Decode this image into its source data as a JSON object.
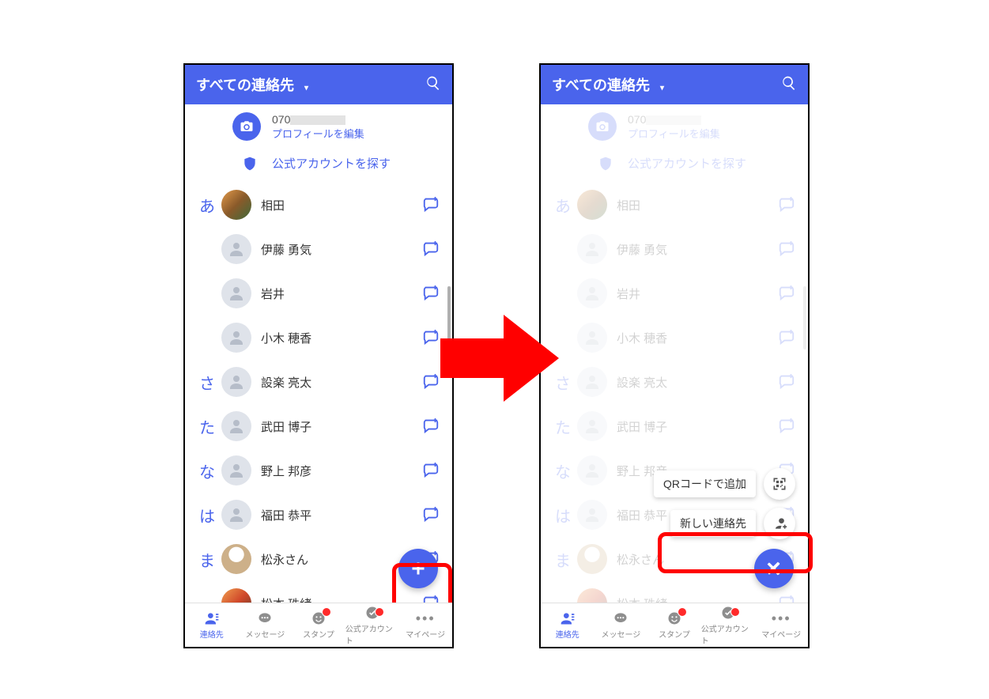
{
  "header": {
    "title": "すべての連絡先",
    "dropdown_glyph": "▾"
  },
  "profile": {
    "phone_prefix": "070",
    "edit_label": "プロフィールを編集"
  },
  "official": {
    "label": "公式アカウントを探す"
  },
  "contacts": [
    {
      "index": "あ",
      "name": "相田",
      "avatar": "img1"
    },
    {
      "index": "",
      "name": "伊藤 勇気",
      "avatar": "default"
    },
    {
      "index": "",
      "name": "岩井",
      "avatar": "default"
    },
    {
      "index": "",
      "name": "小木 穂香",
      "avatar": "default"
    },
    {
      "index": "さ",
      "name": "設楽 亮太",
      "avatar": "default"
    },
    {
      "index": "た",
      "name": "武田 博子",
      "avatar": "default"
    },
    {
      "index": "な",
      "name": "野上 邦彦",
      "avatar": "default"
    },
    {
      "index": "は",
      "name": "福田 恭平",
      "avatar": "default"
    },
    {
      "index": "ま",
      "name": "松永さん",
      "avatar": "img2"
    },
    {
      "index": "",
      "name": "松本 珠緒",
      "avatar": "img3"
    }
  ],
  "fab": {
    "state_left": "plus",
    "state_right": "close"
  },
  "menu": {
    "qr_label": "QRコードで追加",
    "new_contact_label": "新しい連絡先"
  },
  "nav": {
    "items": [
      {
        "key": "contacts",
        "label": "連絡先",
        "active": true,
        "badge": false
      },
      {
        "key": "messages",
        "label": "メッセージ",
        "active": false,
        "badge": false
      },
      {
        "key": "stamps",
        "label": "スタンプ",
        "active": false,
        "badge": true
      },
      {
        "key": "official",
        "label": "公式アカウント",
        "active": false,
        "badge": true
      },
      {
        "key": "mypage",
        "label": "マイページ",
        "active": false,
        "badge": false
      }
    ]
  },
  "colors": {
    "accent": "#4a64ec",
    "highlight": "#ff0000"
  }
}
